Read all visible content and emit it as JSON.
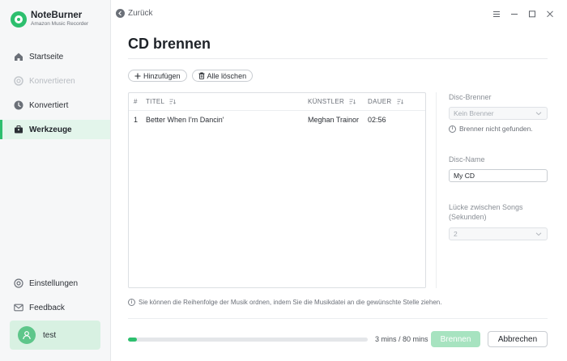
{
  "app": {
    "name": "NoteBurner",
    "subtitle": "Amazon Music Recorder"
  },
  "sidebar": {
    "items": [
      {
        "label": "Startseite",
        "icon": "home-icon",
        "state": "normal"
      },
      {
        "label": "Konvertieren",
        "icon": "convert-icon",
        "state": "disabled"
      },
      {
        "label": "Konvertiert",
        "icon": "clock-icon",
        "state": "normal"
      },
      {
        "label": "Werkzeuge",
        "icon": "toolbox-icon",
        "state": "active"
      }
    ],
    "bottom_items": [
      {
        "label": "Einstellungen",
        "icon": "gear-icon"
      },
      {
        "label": "Feedback",
        "icon": "mail-icon"
      }
    ],
    "user": {
      "name": "test"
    }
  },
  "topbar": {
    "back_label": "Zurück"
  },
  "page": {
    "title": "CD brennen"
  },
  "toolbar": {
    "add_label": "Hinzufügen",
    "clear_label": "Alle löschen"
  },
  "table": {
    "headers": {
      "num": "#",
      "title": "TITEL",
      "artist": "KÜNSTLER",
      "duration": "DAUER"
    },
    "rows": [
      {
        "num": "1",
        "title": "Better When I'm Dancin'",
        "artist": "Meghan Trainor",
        "duration": "02:56"
      }
    ]
  },
  "panel": {
    "burner_label": "Disc-Brenner",
    "burner_value": "Kein Brenner",
    "burner_note": "Brenner nicht gefunden.",
    "disc_name_label": "Disc-Name",
    "disc_name_value": "My CD",
    "gap_label_line1": "Lücke zwischen Songs",
    "gap_label_line2": "(Sekunden)",
    "gap_value": "2"
  },
  "hint": "Sie können die Reihenfolge der Musik ordnen, indem Sie die Musikdatei an die gewünschte Stelle ziehen.",
  "footer": {
    "progress_fraction": 0.0375,
    "progress_text": "3 mins / 80 mins",
    "burn_label": "Brennen",
    "cancel_label": "Abbrechen"
  },
  "colors": {
    "accent": "#2dbf6e",
    "accent_light": "#e3f5eb",
    "burn_disabled": "#a7e3c0"
  }
}
